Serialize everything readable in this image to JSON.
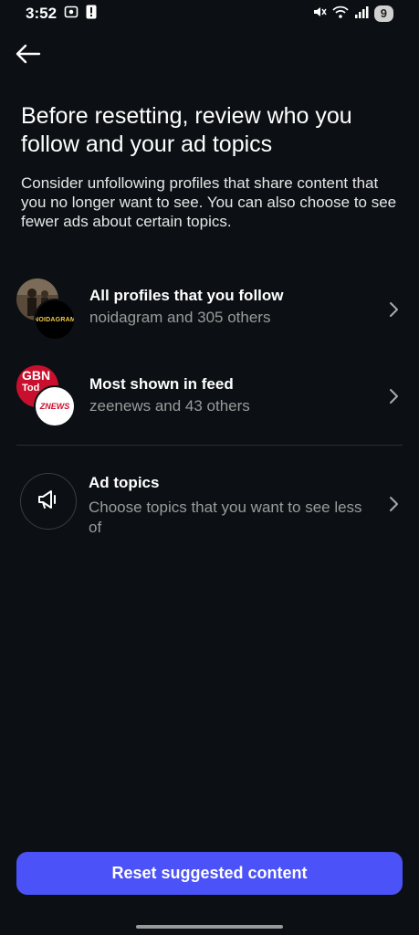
{
  "status_bar": {
    "time": "3:52",
    "battery": "9"
  },
  "title": "Before resetting, review who you follow and your ad topics",
  "subtitle": "Consider unfollowing profiles that share content that you no longer want to see. You can also choose to see fewer ads about certain topics.",
  "rows": [
    {
      "title": "All profiles that you follow",
      "subtitle": "noidagram and 305 others",
      "avatar_label": "NOIDAGRAM"
    },
    {
      "title": "Most shown in feed",
      "subtitle": "zeenews and 43 others",
      "avatar_back_label": "GBN",
      "avatar_back_label2": "Tod",
      "avatar_front_label": "ZNEWS"
    },
    {
      "title": "Ad topics",
      "subtitle": "Choose topics that you want to see less of"
    }
  ],
  "reset_button": "Reset suggested content",
  "colors": {
    "background": "#0c1014",
    "accent": "#4b52f7",
    "muted_text": "#9a9a9a"
  }
}
